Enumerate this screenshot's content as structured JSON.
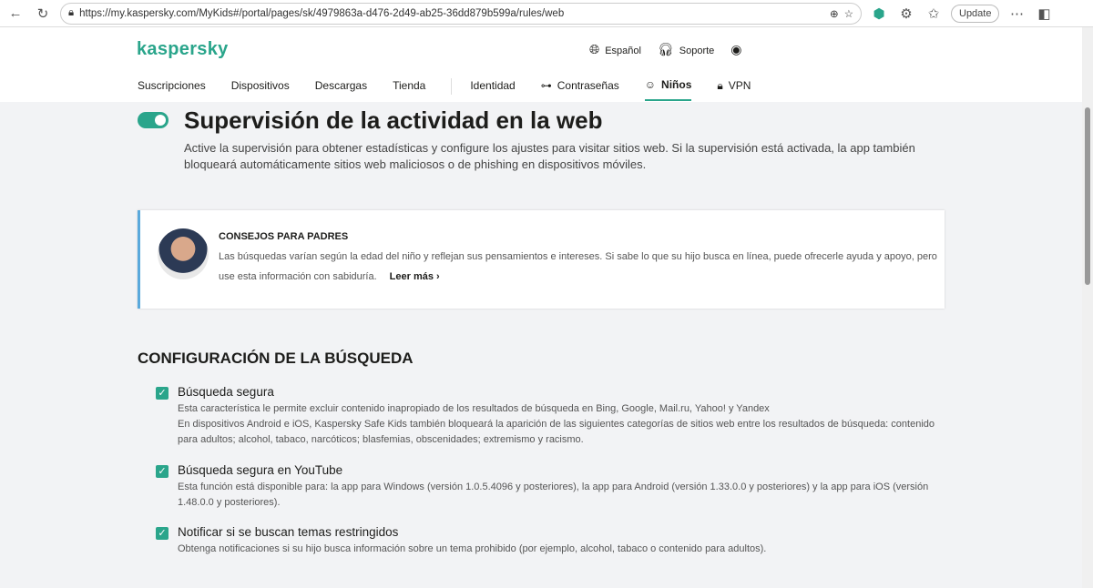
{
  "browser": {
    "url": "https://my.kaspersky.com/MyKids#/portal/pages/sk/4979863a-d476-2d49-ab25-36dd879b599a/rules/web",
    "update_label": "Update"
  },
  "header": {
    "logo": "kaspersky",
    "language": "Español",
    "support": "Soporte",
    "nav": [
      "Suscripciones",
      "Dispositivos",
      "Descargas",
      "Tienda",
      "Identidad",
      "Contraseñas",
      "Niños",
      "VPN"
    ]
  },
  "page": {
    "title": "Supervisión de la actividad en la web",
    "toggle_on": true,
    "description": "Active la supervisión para obtener estadísticas y configure los ajustes para visitar sitios web. Si la supervisión está activada, la app también bloqueará automáticamente sitios web maliciosos o de phishing en dispositivos móviles."
  },
  "tip": {
    "title": "CONSEJOS PARA PADRES",
    "text": "Las búsquedas varían según la edad del niño y reflejan sus pensamientos e intereses. Si sabe lo que su hijo busca en línea, puede ofrecerle ayuda y apoyo, pero use esta información con sabiduría.",
    "more": "Leer más"
  },
  "search": {
    "heading": "CONFIGURACIÓN DE LA BÚSQUEDA",
    "options": [
      {
        "label": "Búsqueda segura",
        "checked": true,
        "desc1": "Esta característica le permite excluir contenido inapropiado de los resultados de búsqueda en Bing, Google, Mail.ru, Yahoo! y Yandex",
        "desc2": "En dispositivos Android e iOS, Kaspersky Safe Kids también bloqueará la aparición de las siguientes categorías de sitios web entre los resultados de búsqueda: contenido para adultos; alcohol, tabaco, narcóticos; blasfemias, obscenidades; extremismo y racismo."
      },
      {
        "label": "Búsqueda segura en YouTube",
        "checked": true,
        "desc1": "Esta función está disponible para: la app para Windows (versión 1.0.5.4096 y posteriores), la app para Android (versión 1.33.0.0 y posteriores) y la app para iOS (versión 1.48.0.0 y posteriores)."
      },
      {
        "label": "Notificar si se buscan temas restringidos",
        "checked": true,
        "desc1": "Obtenga notificaciones si su hijo busca información sobre un tema prohibido (por ejemplo, alcohol, tabaco o contenido para adultos)."
      }
    ]
  }
}
